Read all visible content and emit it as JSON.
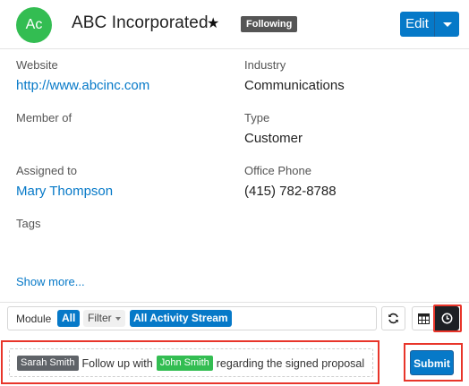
{
  "header": {
    "avatar_initials": "Ac",
    "record_name": "ABC Incorporated",
    "following_label": "Following",
    "edit_label": "Edit"
  },
  "fields": {
    "website": {
      "label": "Website",
      "value": "http://www.abcinc.com"
    },
    "industry": {
      "label": "Industry",
      "value": "Communications"
    },
    "member_of": {
      "label": "Member of",
      "value": ""
    },
    "type": {
      "label": "Type",
      "value": "Customer"
    },
    "assigned_to": {
      "label": "Assigned to",
      "value": "Mary Thompson"
    },
    "office_phone": {
      "label": "Office Phone",
      "value": "(415) 782-8788"
    },
    "tags": {
      "label": "Tags",
      "value": ""
    }
  },
  "show_more_label": "Show more...",
  "activity_toolbar": {
    "module_label": "Module",
    "module_value": "All",
    "filter_label": "Filter",
    "filter_value": "All Activity Stream"
  },
  "composer": {
    "mention_user": "Sarah Smith",
    "text_before": "Follow up with",
    "mention_contact": "John Smith",
    "text_after": "regarding the signed proposal",
    "submit_label": "Submit"
  },
  "colors": {
    "accent": "#0679c8",
    "avatar_bg": "#33bd52",
    "highlight": "#e8352a",
    "badge_bg": "#555555"
  },
  "icons": {
    "star": "star-icon",
    "refresh": "refresh-icon",
    "list_view": "table-icon",
    "activity_view": "clock-icon",
    "dropdown": "caret-down-icon"
  }
}
